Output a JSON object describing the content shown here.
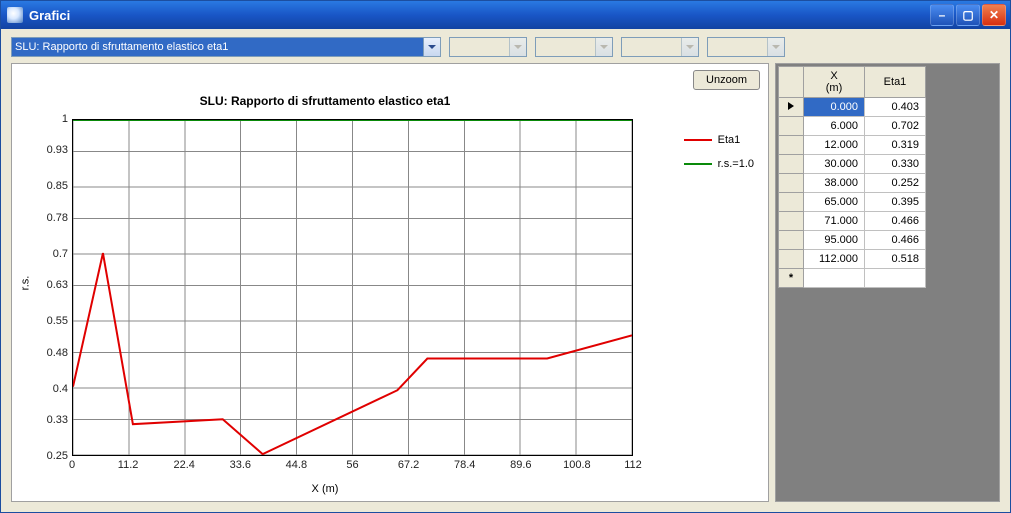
{
  "window": {
    "title": "Grafici"
  },
  "titlebar_buttons": {
    "min": "–",
    "max": "▢",
    "close": "✕"
  },
  "combo": {
    "selected": "SLU: Rapporto di sfruttamento elastico eta1"
  },
  "unzoom_label": "Unzoom",
  "legend": {
    "eta1": "Eta1",
    "rs1": "r.s.=1.0"
  },
  "axes": {
    "xlabel": "X (m)",
    "ylabel": "r.s."
  },
  "table": {
    "headers": {
      "x": "X\n(m)",
      "eta1": "Eta1"
    },
    "selected_row": 0,
    "rows_x": [
      "0.000",
      "6.000",
      "12.000",
      "30.000",
      "38.000",
      "65.000",
      "71.000",
      "95.000",
      "112.000"
    ],
    "rows_eta": [
      "0.403",
      "0.702",
      "0.319",
      "0.330",
      "0.252",
      "0.395",
      "0.466",
      "0.466",
      "0.518"
    ]
  },
  "chart_data": {
    "type": "line",
    "title": "SLU: Rapporto di sfruttamento elastico eta1",
    "xlabel": "X (m)",
    "ylabel": "r.s.",
    "xlim": [
      0,
      112
    ],
    "ylim": [
      0.25,
      1.0
    ],
    "xticks": [
      0,
      11.2,
      22.4,
      33.6,
      44.8,
      56,
      67.2,
      78.4,
      89.6,
      100.8,
      112
    ],
    "yticks": [
      0.25,
      0.33,
      0.4,
      0.48,
      0.55,
      0.63,
      0.7,
      0.78,
      0.85,
      0.93,
      1.0
    ],
    "series": [
      {
        "name": "Eta1",
        "color": "#e00000",
        "x": [
          0,
          6,
          12,
          30,
          38,
          65,
          71,
          95,
          112
        ],
        "y": [
          0.403,
          0.702,
          0.319,
          0.33,
          0.252,
          0.395,
          0.466,
          0.466,
          0.518
        ]
      },
      {
        "name": "r.s.=1.0",
        "color": "#0a8a0a",
        "x": [
          0,
          112
        ],
        "y": [
          1.0,
          1.0
        ]
      }
    ]
  }
}
